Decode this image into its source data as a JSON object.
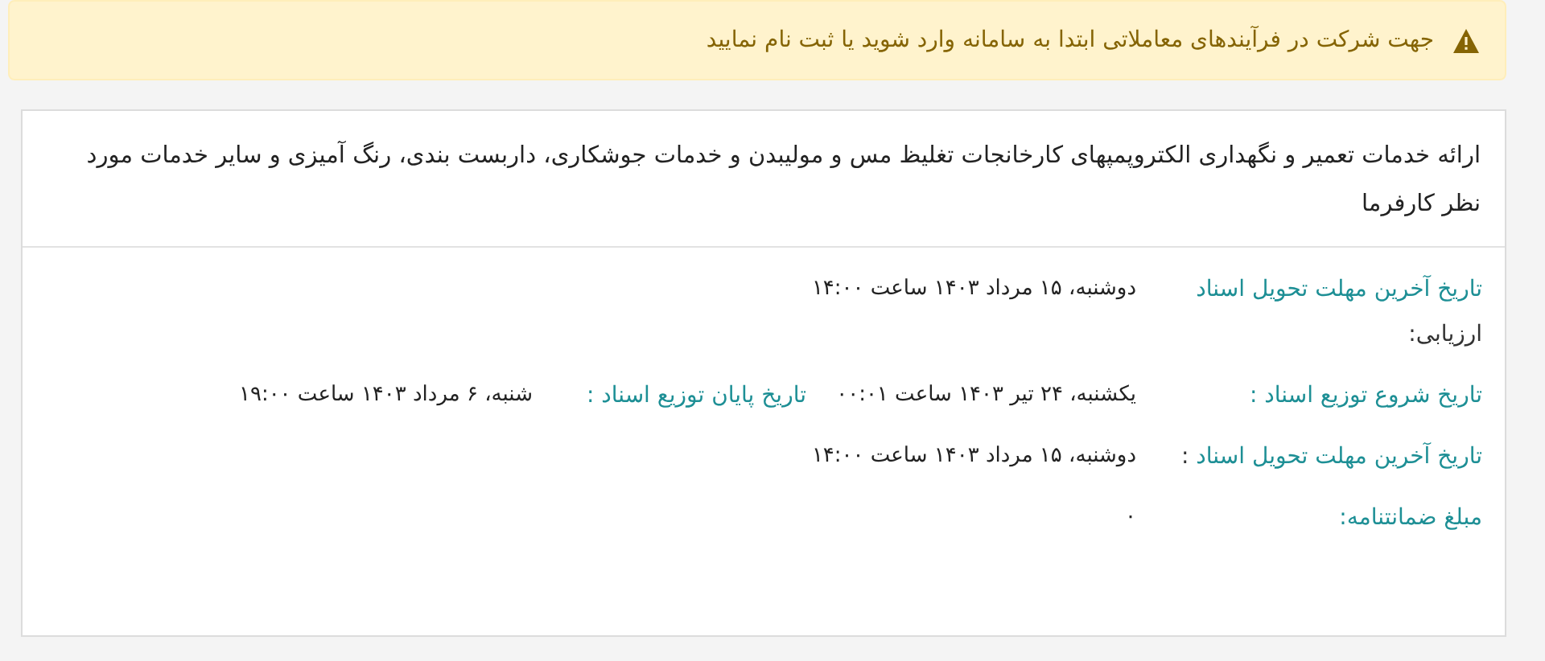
{
  "alert": {
    "text": "جهت شرکت در فرآیندهای معاملاتی ابتدا به سامانه وارد شوید یا ثبت نام نمایید"
  },
  "card": {
    "title": "ارائه خدمات تعمیر و نگهداری الکتروپمپهای کارخانجات تغلیظ مس و مولیبدن و خدمات جوشکاری، داربست بندی، رنگ آمیزی و سایر خدمات مورد نظر کارفرما",
    "rows": [
      [
        {
          "label": "تاریخ آخرین مهلت تحویل اسناد",
          "suffix": "ارزیابی:",
          "value": "دوشنبه، ۱۵ مرداد ۱۴۰۳ ساعت ۱۴:۰۰"
        }
      ],
      [
        {
          "label": "تاریخ شروع توزیع اسناد :",
          "value": "یکشنبه، ۲۴ تیر ۱۴۰۳ ساعت ۰۰:۰۱"
        },
        {
          "label": "تاریخ پایان توزیع اسناد :",
          "value": "شنبه، ۶ مرداد ۱۴۰۳ ساعت ۱۹:۰۰"
        }
      ],
      [
        {
          "label": "تاریخ آخرین مهلت تحویل اسناد",
          "suffix": ":",
          "value": "دوشنبه، ۱۵ مرداد ۱۴۰۳ ساعت ۱۴:۰۰"
        }
      ],
      [
        {
          "label": "مبلغ ضمانتنامه:",
          "value": "۰"
        }
      ]
    ]
  }
}
